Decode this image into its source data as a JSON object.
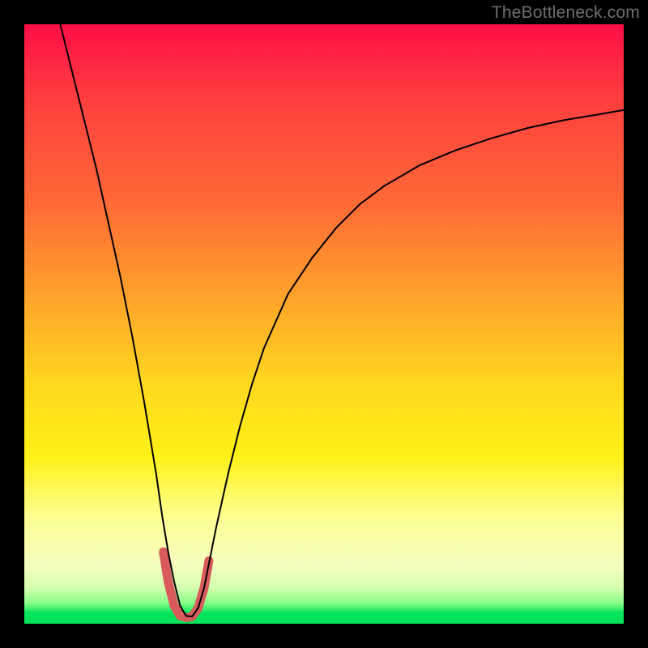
{
  "watermark": "TheBottleneck.com",
  "chart_data": {
    "type": "line",
    "title": "",
    "xlabel": "",
    "ylabel": "",
    "xlim": [
      0,
      100
    ],
    "ylim": [
      0,
      100
    ],
    "grid": false,
    "legend": false,
    "annotations": [],
    "background_gradient_top_to_bottom": [
      "#ff0e46",
      "#ff6a36",
      "#ffd81f",
      "#fdff8f",
      "#05e35a"
    ],
    "valley_x_percent_approx": 27,
    "series": [
      {
        "name": "bottleneck-curve",
        "color": "#000000",
        "stroke_width": 2,
        "x": [
          6,
          8,
          10,
          12,
          14,
          16,
          18,
          20,
          21,
          22,
          23,
          24,
          25,
          26,
          27,
          28,
          29,
          30,
          31,
          32,
          34,
          36,
          38,
          40,
          44,
          48,
          52,
          56,
          60,
          66,
          72,
          78,
          84,
          90,
          96,
          100
        ],
        "y": [
          100,
          92,
          84,
          76,
          67,
          58,
          48,
          37,
          31,
          25,
          18,
          12,
          7,
          3.0,
          1.3,
          1.2,
          2.6,
          6,
          11,
          16,
          25,
          33,
          40,
          46,
          55,
          61,
          66,
          70,
          73,
          76.5,
          79,
          81,
          82.7,
          84,
          85,
          85.7
        ]
      },
      {
        "name": "valley-highlight",
        "color": "#d85a5a",
        "stroke_width": 11,
        "stroke_linecap": "round",
        "x": [
          23.2,
          24,
          25,
          26,
          27,
          28,
          29,
          30,
          30.8
        ],
        "y": [
          12,
          7,
          3.0,
          1.3,
          1.0,
          1.2,
          2.6,
          6,
          10.5
        ]
      }
    ]
  }
}
